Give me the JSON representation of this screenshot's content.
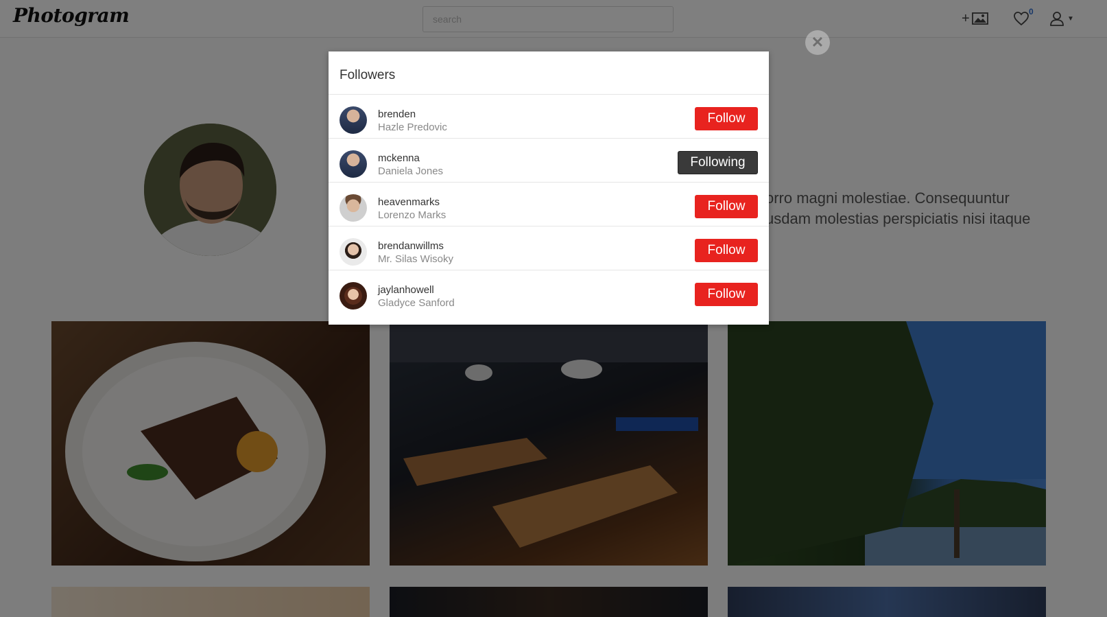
{
  "navbar": {
    "logo": "Photogram",
    "search_placeholder": "search",
    "likes_count": "0"
  },
  "profile": {
    "bio_lines": [
      "orro magni molestiae. Consequuntur",
      "usdam molestias perspiciatis nisi itaque"
    ]
  },
  "modal": {
    "title": "Followers",
    "rows": [
      {
        "username": "brenden",
        "full_name": "Hazle Predovic",
        "action": "Follow"
      },
      {
        "username": "mckenna",
        "full_name": "Daniela Jones",
        "action": "Following"
      },
      {
        "username": "heavenmarks",
        "full_name": "Lorenzo Marks",
        "action": "Follow"
      },
      {
        "username": "brendanwillms",
        "full_name": "Mr. Silas Wisoky",
        "action": "Follow"
      },
      {
        "username": "jaylanhowell",
        "full_name": "Gladyce Sanford",
        "action": "Follow"
      }
    ]
  },
  "colors": {
    "follow": "#e8231f",
    "following": "#3a3a3a",
    "badge": "#2f6fd0"
  },
  "icons": [
    "add-photo-icon",
    "heart-icon",
    "user-icon",
    "close-icon"
  ]
}
